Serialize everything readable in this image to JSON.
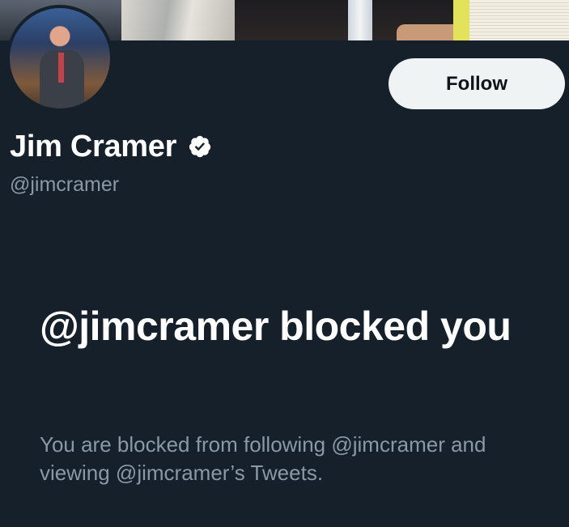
{
  "profile": {
    "name": "Jim Cramer",
    "handle": "@jimcramer",
    "verified": true,
    "verified_icon": "verified-badge-icon"
  },
  "follow_button": {
    "label": "Follow"
  },
  "blocked_notice": {
    "title": "@jimcramer blocked you",
    "description": "You are blocked from following @jimcramer and viewing @jimcramer’s Tweets."
  },
  "colors": {
    "background": "#15202b",
    "primary_text": "#ffffff",
    "secondary_text": "#8b98a5",
    "button_bg": "#eff3f4",
    "button_text": "#0f1419"
  }
}
